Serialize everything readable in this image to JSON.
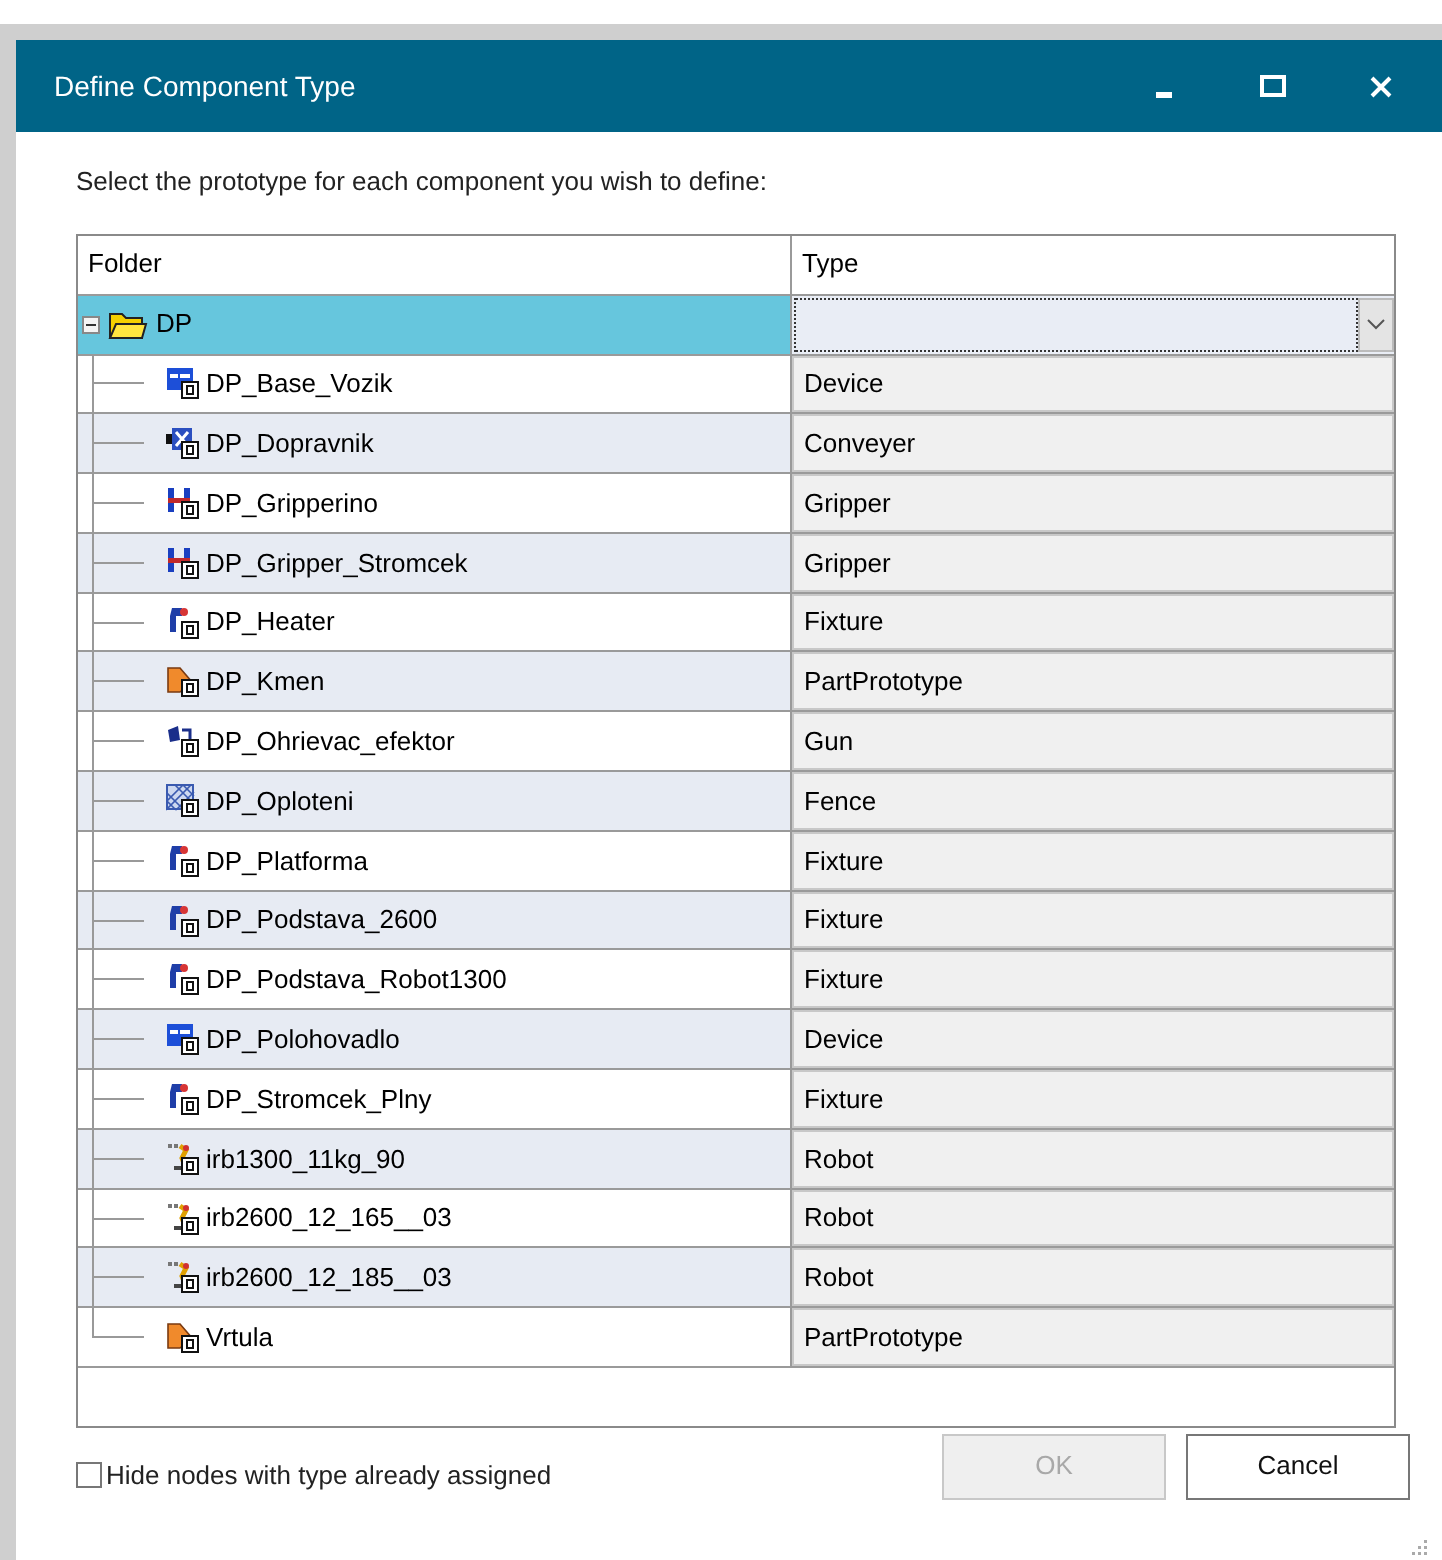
{
  "window": {
    "title": "Define Component Type"
  },
  "instruction": "Select the prototype for each component you wish to define:",
  "table": {
    "columns": [
      "Folder",
      "Type"
    ],
    "root": {
      "label": "DP",
      "expanded": true,
      "selected": true,
      "children": [
        {
          "label": "DP_Base_Vozik",
          "kind": "device",
          "type": "Device"
        },
        {
          "label": "DP_Dopravnik",
          "kind": "conveyer",
          "type": "Conveyer"
        },
        {
          "label": "DP_Gripperino",
          "kind": "gripper",
          "type": "Gripper"
        },
        {
          "label": "DP_Gripper_Stromcek",
          "kind": "gripper",
          "type": "Gripper"
        },
        {
          "label": "DP_Heater",
          "kind": "fixture",
          "type": "Fixture"
        },
        {
          "label": "DP_Kmen",
          "kind": "part",
          "type": "PartPrototype"
        },
        {
          "label": "DP_Ohrievac_efektor",
          "kind": "gun",
          "type": "Gun"
        },
        {
          "label": "DP_Oploteni",
          "kind": "fence",
          "type": "Fence"
        },
        {
          "label": "DP_Platforma",
          "kind": "fixture",
          "type": "Fixture"
        },
        {
          "label": "DP_Podstava_2600",
          "kind": "fixture",
          "type": "Fixture"
        },
        {
          "label": "DP_Podstava_Robot1300",
          "kind": "fixture",
          "type": "Fixture"
        },
        {
          "label": "DP_Polohovadlo",
          "kind": "device",
          "type": "Device"
        },
        {
          "label": "DP_Stromcek_Plny",
          "kind": "fixture",
          "type": "Fixture"
        },
        {
          "label": "irb1300_11kg_90",
          "kind": "robot",
          "type": "Robot"
        },
        {
          "label": "irb2600_12_165__03",
          "kind": "robot",
          "type": "Robot"
        },
        {
          "label": "irb2600_12_185__03",
          "kind": "robot",
          "type": "Robot"
        },
        {
          "label": "Vrtula",
          "kind": "part",
          "type": "PartPrototype"
        }
      ]
    }
  },
  "hide_assigned": {
    "label": "Hide nodes with type already assigned",
    "checked": false
  },
  "buttons": [
    {
      "label": "OK",
      "disabled": true
    },
    {
      "label": "Cancel",
      "disabled": false
    }
  ]
}
